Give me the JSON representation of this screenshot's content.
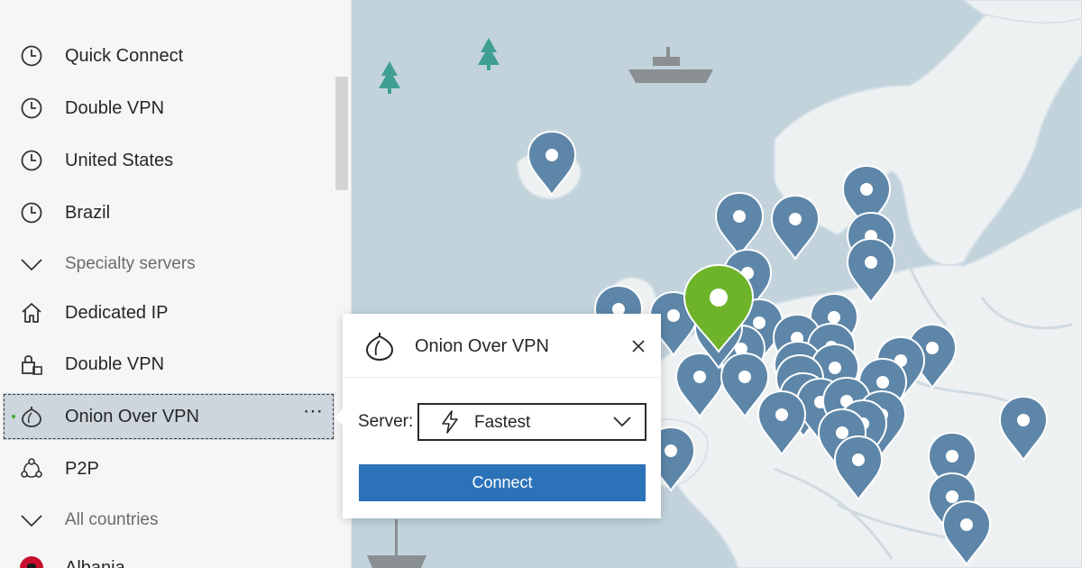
{
  "sidebar": {
    "items": [
      {
        "label": "Quick Connect",
        "icon": "clock-icon"
      },
      {
        "label": "Double VPN",
        "icon": "clock-icon"
      },
      {
        "label": "United States",
        "icon": "clock-icon"
      },
      {
        "label": "Brazil",
        "icon": "clock-icon"
      },
      {
        "label": "Specialty servers",
        "icon": "chevron-down-icon"
      },
      {
        "label": "Dedicated IP",
        "icon": "home-icon"
      },
      {
        "label": "Double VPN",
        "icon": "lock-icon"
      },
      {
        "label": "Onion Over VPN",
        "icon": "onion-icon",
        "more": "⋯"
      },
      {
        "label": "P2P",
        "icon": "p2p-icon"
      },
      {
        "label": "All countries",
        "icon": "chevron-down-icon"
      },
      {
        "label": "Albania",
        "icon": "albania-flag-icon"
      }
    ]
  },
  "popup": {
    "title": "Onion Over VPN",
    "server_label": "Server:",
    "server_value": "Fastest",
    "connect_label": "Connect"
  },
  "map": {
    "region": "Europe",
    "pin_color": "#5d86a8",
    "active_pin_color": "#6eb42a",
    "land_color": "#eef1f2",
    "water_color": "#c2d3dc"
  },
  "colors": {
    "accent": "#2c72b8",
    "selected_row": "#cdd5dd",
    "active_dot": "#3daa2a"
  }
}
